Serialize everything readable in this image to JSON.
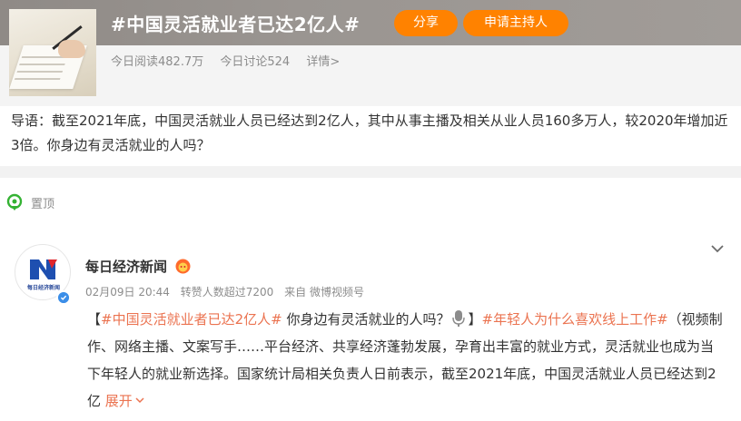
{
  "topic": {
    "title": "#中国灵活就业者已达2亿人#",
    "share_label": "分享",
    "host_label": "申请主持人",
    "reads": "今日阅读482.7万",
    "discussions": "今日讨论524",
    "details": "详情>"
  },
  "intro": "导语：截至2021年底，中国灵活就业人员已经达到2亿人，其中从事主播及相关从业人员160多万人，较2020年增加近3倍。你身边有灵活就业的人吗？",
  "pinned_label": "置顶",
  "post": {
    "author": "每日经济新闻",
    "avatar_caption": "每日经济新闻",
    "date_time": "02月09日 20:44",
    "reposts": "转赞人数超过7200",
    "source": "来自 微博视频号",
    "bracket_open": "【",
    "bracket_close": "】",
    "tag1": "#中国灵活就业者已达2亿人#",
    "question": " 你身边有灵活就业的人吗？",
    "tag2": "#年轻人为什么喜欢线上工作#",
    "body": "（视频制作、网络主播、文案写手……平台经济、共享经济蓬勃发展，孕育出丰富的就业方式，灵活就业也成为当下年轻人的就业新选择。国家统计局相关负责人日前表示，截至2021年底，中国灵活就业人员已经达到2亿 ",
    "expand_label": "展开"
  },
  "colors": {
    "accent": "#ff8200",
    "link": "#eb7350",
    "muted": "#8c8c8c",
    "verified": "#3b8ee8"
  },
  "icons": [
    "pin-icon",
    "chevron-down-icon",
    "microphone-icon",
    "verified-icon",
    "vip-badge-icon"
  ]
}
